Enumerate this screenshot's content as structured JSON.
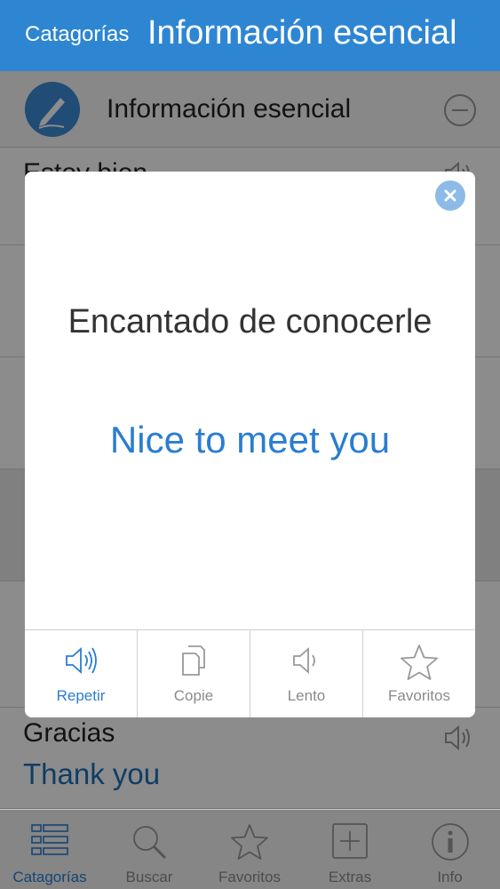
{
  "nav": {
    "back_label": "Catagorías",
    "title": "Información esencial"
  },
  "category": {
    "title": "Información esencial"
  },
  "phrases": [
    {
      "source": "Estoy bien",
      "translation": ""
    },
    {
      "source": "",
      "translation": ""
    },
    {
      "source": "",
      "translation": ""
    },
    {
      "source": "",
      "translation": ""
    },
    {
      "source": "",
      "translation": ""
    },
    {
      "source": "Gracias",
      "translation": "Thank you"
    }
  ],
  "modal": {
    "source": "Encantado de conocerle",
    "translation": "Nice to meet you",
    "actions": [
      {
        "label": "Repetir",
        "icon": "speaker-icon",
        "active": true
      },
      {
        "label": "Copie",
        "icon": "copy-icon",
        "active": false
      },
      {
        "label": "Lento",
        "icon": "speaker-slow-icon",
        "active": false
      },
      {
        "label": "Favoritos",
        "icon": "star-icon",
        "active": false
      }
    ]
  },
  "tabs": [
    {
      "label": "Catagorías",
      "icon": "list-icon",
      "active": true
    },
    {
      "label": "Buscar",
      "icon": "search-icon",
      "active": false
    },
    {
      "label": "Favoritos",
      "icon": "star-icon",
      "active": false
    },
    {
      "label": "Extras",
      "icon": "plus-icon",
      "active": false
    },
    {
      "label": "Info",
      "icon": "info-icon",
      "active": false
    }
  ],
  "colors": {
    "accent": "#2e86d2",
    "translation_text": "#1d6fb8",
    "inactive": "#8a8a8a"
  }
}
